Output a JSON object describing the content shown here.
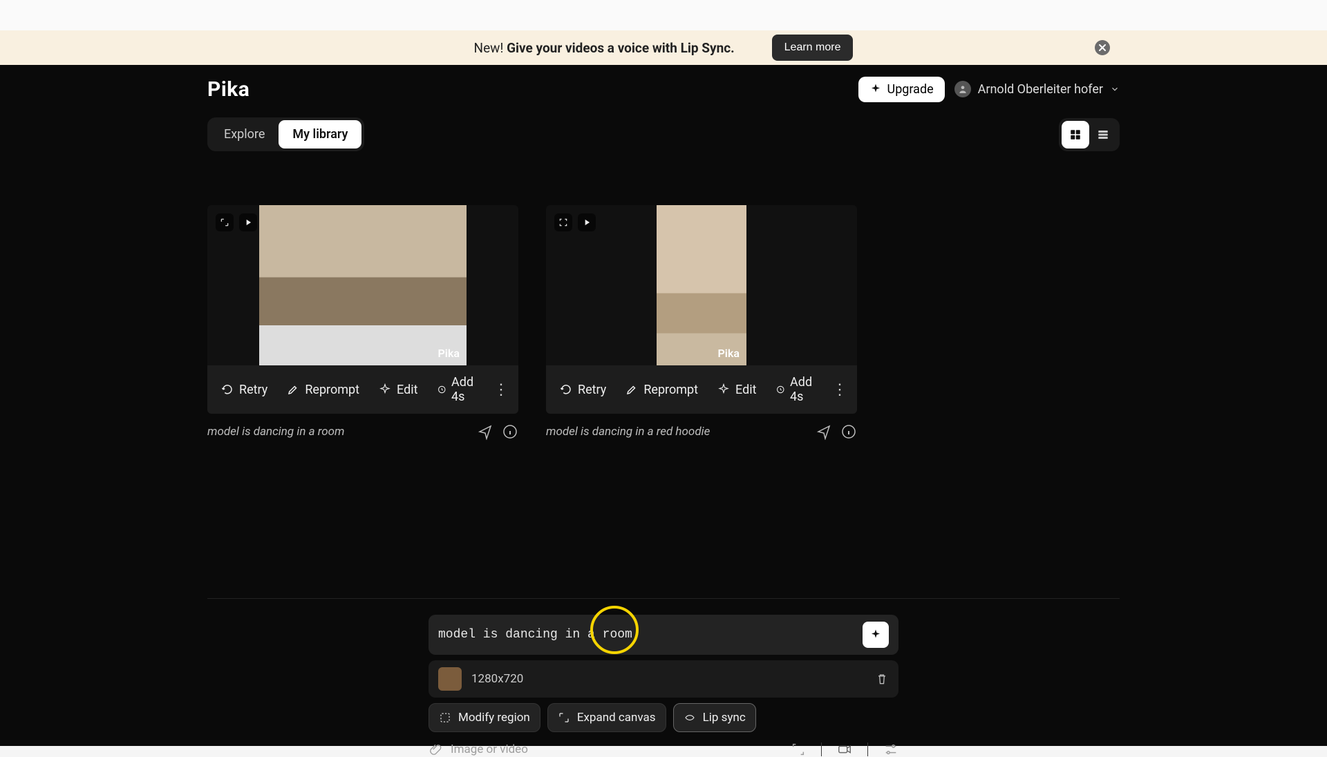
{
  "banner": {
    "text_prefix": "New! ",
    "text_bold": "Give your videos a voice with Lip Sync.",
    "learn_more": "Learn more"
  },
  "header": {
    "logo": "Pika",
    "upgrade": "Upgrade",
    "user_name": "Arnold Oberleiter hofer"
  },
  "tabs": {
    "explore": "Explore",
    "library": "My library"
  },
  "cards": [
    {
      "actions": {
        "retry": "Retry",
        "reprompt": "Reprompt",
        "edit": "Edit",
        "add4s": "Add 4s"
      },
      "caption": "model is dancing in a room",
      "watermark": "Pika"
    },
    {
      "actions": {
        "retry": "Retry",
        "reprompt": "Reprompt",
        "edit": "Edit",
        "add4s": "Add 4s"
      },
      "caption": "model is dancing in a red hoodie",
      "watermark": "Pika"
    }
  ],
  "prompt": {
    "value": "model is dancing in a room",
    "asset_dimensions": "1280x720",
    "tools": {
      "modify": "Modify region",
      "expand": "Expand canvas",
      "lipsync": "Lip sync"
    },
    "attach_label": "Image or video"
  }
}
